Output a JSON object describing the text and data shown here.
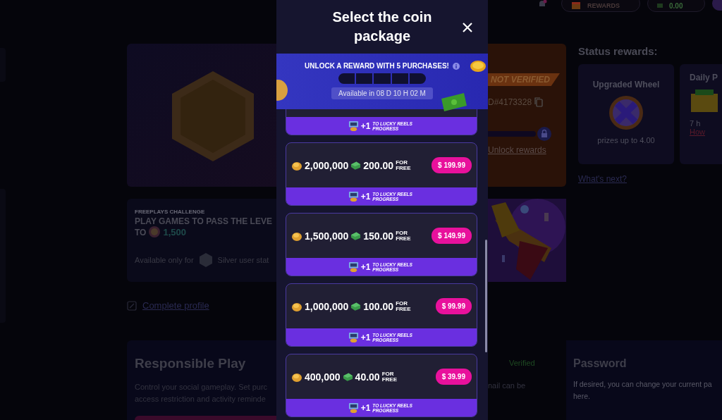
{
  "top_bar": {
    "rewards_label": "REWARDS",
    "balance": "0.00"
  },
  "profile_card": {
    "badge": "NOT VERIFIED",
    "user_id": "D#4173328",
    "unlock_link": "Unlock rewards"
  },
  "status_rewards": {
    "title": "Status rewards:",
    "link": "What's next?",
    "cards": [
      {
        "kind": "wheel",
        "title": "Upgraded Wheel",
        "text": "prizes up to 4.00"
      },
      {
        "kind": "daily",
        "title": "Daily P",
        "text": "7 h",
        "link": "How"
      }
    ]
  },
  "challenge": {
    "eyebrow": "FREEPLAYS CHALLENGE",
    "title": "PLAY GAMES TO PASS THE LEVE",
    "to": "TO",
    "amount": "1,500",
    "availability": "Available only for",
    "status": "Silver user stat"
  },
  "complete_profile": "Complete profile",
  "responsible": {
    "title": "Responsible Play",
    "lines": [
      "Control your social gameplay. Set purc",
      "access restriction and activity reminde"
    ]
  },
  "email": {
    "status": "Verified",
    "text": "nail can be"
  },
  "password": {
    "title": "Password",
    "lines": [
      "If desired, you can change your current pa",
      "here."
    ]
  },
  "modal": {
    "title": "Select the coin package",
    "banner": {
      "title": "UNLOCK A REWARD WITH 5 PURCHASES!",
      "level": 0,
      "availability": "Available in 08 D 10 H 02 M"
    },
    "packages": [
      {
        "bonus": "+1",
        "bonus_text": "TO LUCKY REELS PROGRESS"
      },
      {
        "coins": "2,000,000",
        "cash": "200.00",
        "tag": "FOR FREE",
        "price": "$ 199.99",
        "bonus": "+1",
        "bonus_text": "TO LUCKY REELS PROGRESS"
      },
      {
        "coins": "1,500,000",
        "cash": "150.00",
        "tag": "FOR FREE",
        "price": "$ 149.99",
        "bonus": "+1",
        "bonus_text": "TO LUCKY REELS PROGRESS"
      },
      {
        "coins": "1,000,000",
        "cash": "100.00",
        "tag": "FOR FREE",
        "price": "$ 99.99",
        "bonus": "+1",
        "bonus_text": "TO LUCKY REELS PROGRESS"
      },
      {
        "coins": "400,000",
        "cash": "40.00",
        "tag": "FOR FREE",
        "price": "$ 39.99",
        "bonus": "+1",
        "bonus_text": "TO LUCKY REELS PROGRESS"
      }
    ]
  }
}
